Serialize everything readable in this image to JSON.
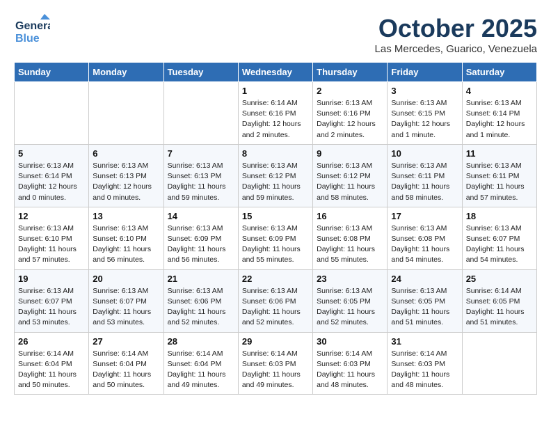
{
  "header": {
    "logo_line1": "General",
    "logo_line2": "Blue",
    "month_title": "October 2025",
    "location": "Las Mercedes, Guarico, Venezuela"
  },
  "weekdays": [
    "Sunday",
    "Monday",
    "Tuesday",
    "Wednesday",
    "Thursday",
    "Friday",
    "Saturday"
  ],
  "weeks": [
    [
      {
        "day": "",
        "info": ""
      },
      {
        "day": "",
        "info": ""
      },
      {
        "day": "",
        "info": ""
      },
      {
        "day": "1",
        "info": "Sunrise: 6:14 AM\nSunset: 6:16 PM\nDaylight: 12 hours and 2 minutes."
      },
      {
        "day": "2",
        "info": "Sunrise: 6:13 AM\nSunset: 6:16 PM\nDaylight: 12 hours and 2 minutes."
      },
      {
        "day": "3",
        "info": "Sunrise: 6:13 AM\nSunset: 6:15 PM\nDaylight: 12 hours and 1 minute."
      },
      {
        "day": "4",
        "info": "Sunrise: 6:13 AM\nSunset: 6:14 PM\nDaylight: 12 hours and 1 minute."
      }
    ],
    [
      {
        "day": "5",
        "info": "Sunrise: 6:13 AM\nSunset: 6:14 PM\nDaylight: 12 hours and 0 minutes."
      },
      {
        "day": "6",
        "info": "Sunrise: 6:13 AM\nSunset: 6:13 PM\nDaylight: 12 hours and 0 minutes."
      },
      {
        "day": "7",
        "info": "Sunrise: 6:13 AM\nSunset: 6:13 PM\nDaylight: 11 hours and 59 minutes."
      },
      {
        "day": "8",
        "info": "Sunrise: 6:13 AM\nSunset: 6:12 PM\nDaylight: 11 hours and 59 minutes."
      },
      {
        "day": "9",
        "info": "Sunrise: 6:13 AM\nSunset: 6:12 PM\nDaylight: 11 hours and 58 minutes."
      },
      {
        "day": "10",
        "info": "Sunrise: 6:13 AM\nSunset: 6:11 PM\nDaylight: 11 hours and 58 minutes."
      },
      {
        "day": "11",
        "info": "Sunrise: 6:13 AM\nSunset: 6:11 PM\nDaylight: 11 hours and 57 minutes."
      }
    ],
    [
      {
        "day": "12",
        "info": "Sunrise: 6:13 AM\nSunset: 6:10 PM\nDaylight: 11 hours and 57 minutes."
      },
      {
        "day": "13",
        "info": "Sunrise: 6:13 AM\nSunset: 6:10 PM\nDaylight: 11 hours and 56 minutes."
      },
      {
        "day": "14",
        "info": "Sunrise: 6:13 AM\nSunset: 6:09 PM\nDaylight: 11 hours and 56 minutes."
      },
      {
        "day": "15",
        "info": "Sunrise: 6:13 AM\nSunset: 6:09 PM\nDaylight: 11 hours and 55 minutes."
      },
      {
        "day": "16",
        "info": "Sunrise: 6:13 AM\nSunset: 6:08 PM\nDaylight: 11 hours and 55 minutes."
      },
      {
        "day": "17",
        "info": "Sunrise: 6:13 AM\nSunset: 6:08 PM\nDaylight: 11 hours and 54 minutes."
      },
      {
        "day": "18",
        "info": "Sunrise: 6:13 AM\nSunset: 6:07 PM\nDaylight: 11 hours and 54 minutes."
      }
    ],
    [
      {
        "day": "19",
        "info": "Sunrise: 6:13 AM\nSunset: 6:07 PM\nDaylight: 11 hours and 53 minutes."
      },
      {
        "day": "20",
        "info": "Sunrise: 6:13 AM\nSunset: 6:07 PM\nDaylight: 11 hours and 53 minutes."
      },
      {
        "day": "21",
        "info": "Sunrise: 6:13 AM\nSunset: 6:06 PM\nDaylight: 11 hours and 52 minutes."
      },
      {
        "day": "22",
        "info": "Sunrise: 6:13 AM\nSunset: 6:06 PM\nDaylight: 11 hours and 52 minutes."
      },
      {
        "day": "23",
        "info": "Sunrise: 6:13 AM\nSunset: 6:05 PM\nDaylight: 11 hours and 52 minutes."
      },
      {
        "day": "24",
        "info": "Sunrise: 6:13 AM\nSunset: 6:05 PM\nDaylight: 11 hours and 51 minutes."
      },
      {
        "day": "25",
        "info": "Sunrise: 6:14 AM\nSunset: 6:05 PM\nDaylight: 11 hours and 51 minutes."
      }
    ],
    [
      {
        "day": "26",
        "info": "Sunrise: 6:14 AM\nSunset: 6:04 PM\nDaylight: 11 hours and 50 minutes."
      },
      {
        "day": "27",
        "info": "Sunrise: 6:14 AM\nSunset: 6:04 PM\nDaylight: 11 hours and 50 minutes."
      },
      {
        "day": "28",
        "info": "Sunrise: 6:14 AM\nSunset: 6:04 PM\nDaylight: 11 hours and 49 minutes."
      },
      {
        "day": "29",
        "info": "Sunrise: 6:14 AM\nSunset: 6:03 PM\nDaylight: 11 hours and 49 minutes."
      },
      {
        "day": "30",
        "info": "Sunrise: 6:14 AM\nSunset: 6:03 PM\nDaylight: 11 hours and 48 minutes."
      },
      {
        "day": "31",
        "info": "Sunrise: 6:14 AM\nSunset: 6:03 PM\nDaylight: 11 hours and 48 minutes."
      },
      {
        "day": "",
        "info": ""
      }
    ]
  ]
}
